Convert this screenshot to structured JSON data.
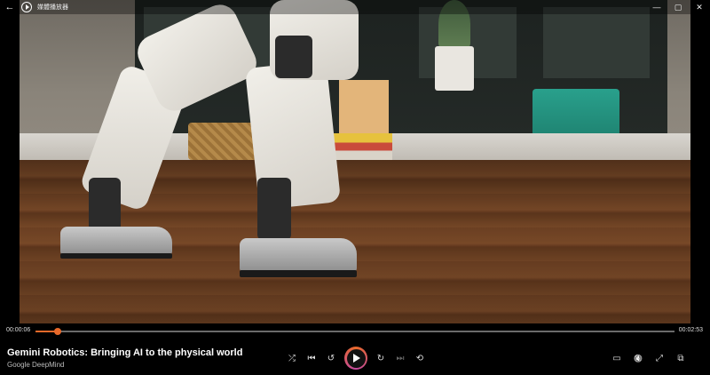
{
  "app": {
    "title": "媒體播放器",
    "back_glyph": "←",
    "window_controls": {
      "minimize": "—",
      "maximize": "▢",
      "close": "✕"
    }
  },
  "video": {
    "title": "Gemini Robotics: Bringing AI to the physical world",
    "channel": "Google DeepMind"
  },
  "playback": {
    "current_time": "00:00:06",
    "total_time": "00:02:53",
    "progress": 0.035,
    "state": "paused"
  },
  "colors": {
    "accent": "#e8692a",
    "accent_secondary": "#c54aa0",
    "track": "#6a6a6a"
  },
  "controls": {
    "center": [
      {
        "name": "shuffle-button",
        "icon": "shuffle-icon",
        "glyph": "⤮",
        "enabled": true
      },
      {
        "name": "previous-button",
        "icon": "skip-previous-icon",
        "glyph": "⏮",
        "enabled": true
      },
      {
        "name": "rewind-button",
        "icon": "rewind-10-icon",
        "glyph": "↺",
        "enabled": true
      },
      {
        "name": "play-button",
        "icon": "play-icon",
        "enabled": true
      },
      {
        "name": "forward-button",
        "icon": "forward-30-icon",
        "glyph": "↻",
        "enabled": true
      },
      {
        "name": "next-button",
        "icon": "skip-next-icon",
        "glyph": "⏭",
        "enabled": false
      },
      {
        "name": "repeat-button",
        "icon": "repeat-icon",
        "glyph": "⟲",
        "enabled": true
      }
    ],
    "right": [
      {
        "name": "captions-button",
        "icon": "captions-icon",
        "glyph": "▭"
      },
      {
        "name": "volume-button",
        "icon": "volume-mute-icon",
        "glyph": "🔇"
      },
      {
        "name": "fullscreen-button",
        "icon": "fullscreen-icon",
        "glyph": "⤢"
      },
      {
        "name": "mini-player-button",
        "icon": "mini-player-icon",
        "glyph": "⧉"
      }
    ]
  }
}
